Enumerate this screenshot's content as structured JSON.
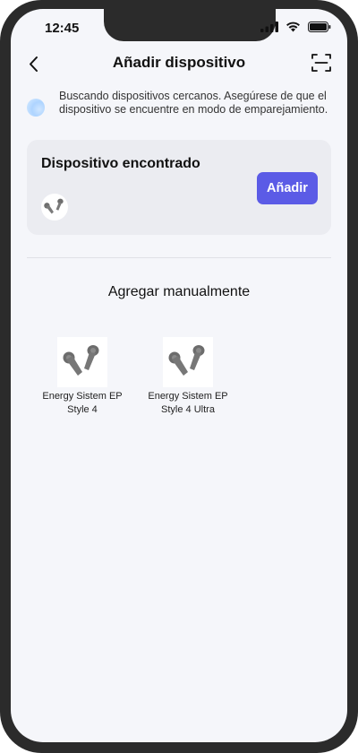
{
  "status_bar": {
    "time": "12:45"
  },
  "header": {
    "title": "Añadir dispositivo"
  },
  "searching": {
    "text": "Buscando dispositivos cercanos. Asegúrese de que el dispositivo se encuentre en modo de emparejamiento."
  },
  "found": {
    "title": "Dispositivo encontrado",
    "add_label": "Añadir"
  },
  "manual": {
    "title": "Agregar manualmente",
    "devices": [
      {
        "name": "Energy Sistem EP Style 4"
      },
      {
        "name": "Energy Sistem EP Style 4 Ultra"
      }
    ]
  },
  "colors": {
    "accent": "#5b5be6",
    "background": "#f5f6fa",
    "card": "#ebecf1"
  }
}
